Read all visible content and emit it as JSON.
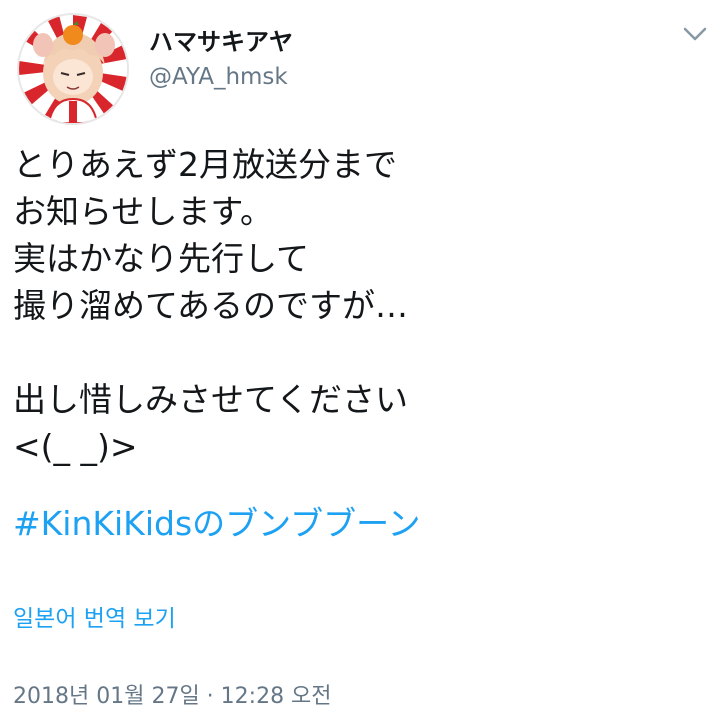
{
  "author": {
    "display_name": "ハマサキアヤ",
    "handle": "@AYA_hmsk"
  },
  "icons": {
    "menu": "chevron-down-icon"
  },
  "tweet": {
    "lines": [
      "とりあえず2月放送分まで",
      "お知らせします。",
      "実はかなり先行して",
      "撮り溜めてあるのですが…",
      "",
      "出し惜しみさせてください",
      "<(_ _)>"
    ],
    "hashtag": "#KinKiKidsのブンブブーン"
  },
  "translate_label": "일본어 번역 보기",
  "timestamp": "2018년 01월 27일 · 12:28 오전",
  "colors": {
    "link": "#1da1f2",
    "secondary_text": "#657786",
    "primary_text": "#14171a"
  }
}
